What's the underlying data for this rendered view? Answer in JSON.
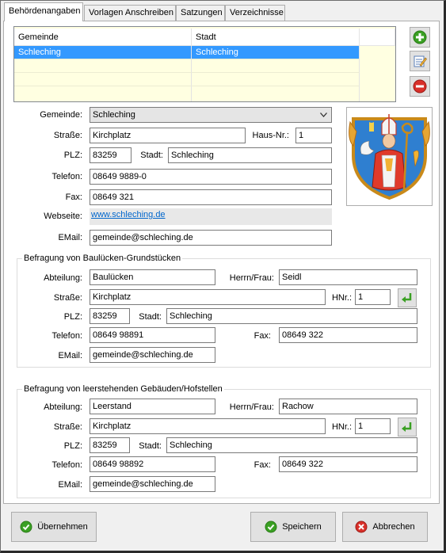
{
  "tabs": [
    "Behördenangaben",
    "Vorlagen Anschreiben",
    "Satzungen",
    "Verzeichnisse"
  ],
  "grid": {
    "headers": [
      "Gemeinde",
      "Stadt"
    ],
    "rows": [
      [
        "Schleching",
        "Schleching"
      ]
    ]
  },
  "form": {
    "gemeinde_label": "Gemeinde:",
    "gemeinde_value": "Schleching",
    "strasse_label": "Straße:",
    "strasse_value": "Kirchplatz",
    "hausnr_label": "Haus-Nr.:",
    "hausnr_value": "1",
    "plz_label": "PLZ:",
    "plz_value": "83259",
    "stadt_label": "Stadt:",
    "stadt_value": "Schleching",
    "telefon_label": "Telefon:",
    "telefon_value": "08649 9889-0",
    "fax_label": "Fax:",
    "fax_value": "08649 321",
    "webseite_label": "Webseite:",
    "webseite_value": "www.schleching.de",
    "email_label": "EMail:",
    "email_value": "gemeinde@schleching.de"
  },
  "group1": {
    "title": "Befragung von Baulücken-Grundstücken",
    "abteilung_label": "Abteilung:",
    "abteilung_value": "Baulücken",
    "herr_label": "Herrn/Frau:",
    "herr_value": "Seidl",
    "strasse_label": "Straße:",
    "strasse_value": "Kirchplatz",
    "hnr_label": "HNr.:",
    "hnr_value": "1",
    "plz_label": "PLZ:",
    "plz_value": "83259",
    "stadt_label": "Stadt:",
    "stadt_value": "Schleching",
    "telefon_label": "Telefon:",
    "telefon_value": "08649 98891",
    "fax_label": "Fax:",
    "fax_value": "08649 322",
    "email_label": "EMail:",
    "email_value": "gemeinde@schleching.de"
  },
  "group2": {
    "title": "Befragung von leerstehenden Gebäuden/Hofstellen",
    "abteilung_label": "Abteilung:",
    "abteilung_value": "Leerstand",
    "herr_label": "Herrn/Frau:",
    "herr_value": "Rachow",
    "strasse_label": "Straße:",
    "strasse_value": "Kirchplatz",
    "hnr_label": "HNr.:",
    "hnr_value": "1",
    "plz_label": "PLZ:",
    "plz_value": "83259",
    "stadt_label": "Stadt:",
    "stadt_value": "Schleching",
    "telefon_label": "Telefon:",
    "telefon_value": "08649 98892",
    "fax_label": "Fax:",
    "fax_value": "08649 322",
    "email_label": "EMail:",
    "email_value": "gemeinde@schleching.de"
  },
  "buttons": {
    "uebernehmen": "Übernehmen",
    "speichern": "Speichern",
    "abbrechen": "Abbrechen"
  },
  "icons": {
    "add": "add-icon",
    "edit": "edit-icon",
    "delete": "delete-icon",
    "copy_address": "arrow-return-icon",
    "crest": "coat-of-arms-icon",
    "check": "check-icon",
    "cancel": "cancel-icon"
  },
  "colors": {
    "selection": "#3399ff",
    "grid_background": "#ffffe1",
    "link": "#0066cc",
    "add_green": "#3aa023",
    "delete_red": "#d9302a"
  }
}
